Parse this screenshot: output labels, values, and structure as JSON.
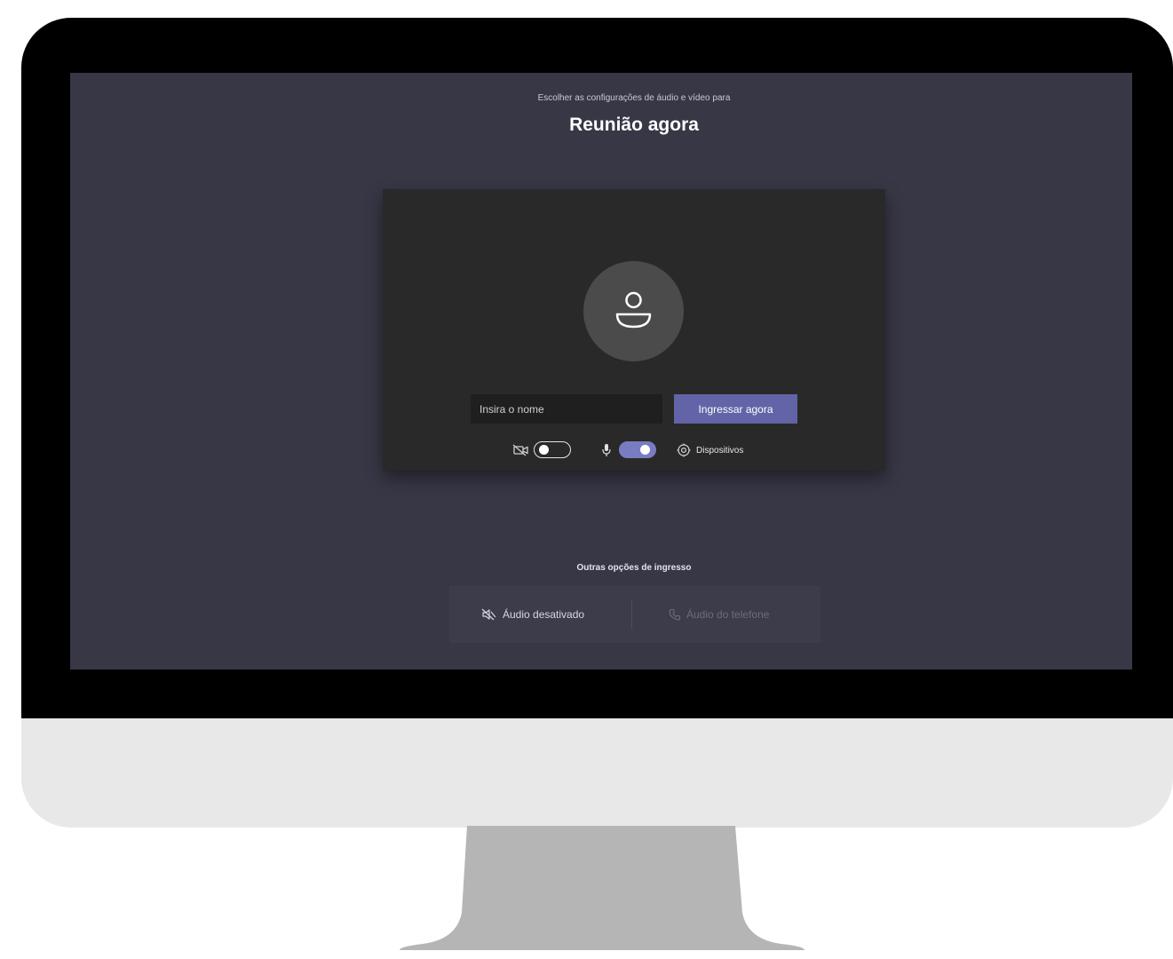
{
  "header": {
    "subtitle": "Escolher as configurações de áudio e vídeo para",
    "title": "Reunião agora"
  },
  "prejoin": {
    "avatar_icon": "person-icon",
    "name_input": {
      "value": "",
      "placeholder": "Insira o nome"
    },
    "join_button_label": "Ingressar agora",
    "join_button_color": "#6264a7",
    "video_toggle": {
      "icon": "camera-off-icon",
      "on": false
    },
    "mic_toggle": {
      "icon": "microphone-icon",
      "on": true,
      "color": "#7a7cc2"
    },
    "devices": {
      "icon": "gear-icon",
      "label": "Dispositivos"
    }
  },
  "other_options": {
    "title": "Outras opções de ingresso",
    "items": [
      {
        "icon": "speaker-off-icon",
        "label": "Áudio desativado",
        "enabled": true
      },
      {
        "icon": "phone-icon",
        "label": "Áudio do telefone",
        "enabled": false
      }
    ]
  },
  "colors": {
    "screen_background": "#383746",
    "card_background": "#292929"
  }
}
